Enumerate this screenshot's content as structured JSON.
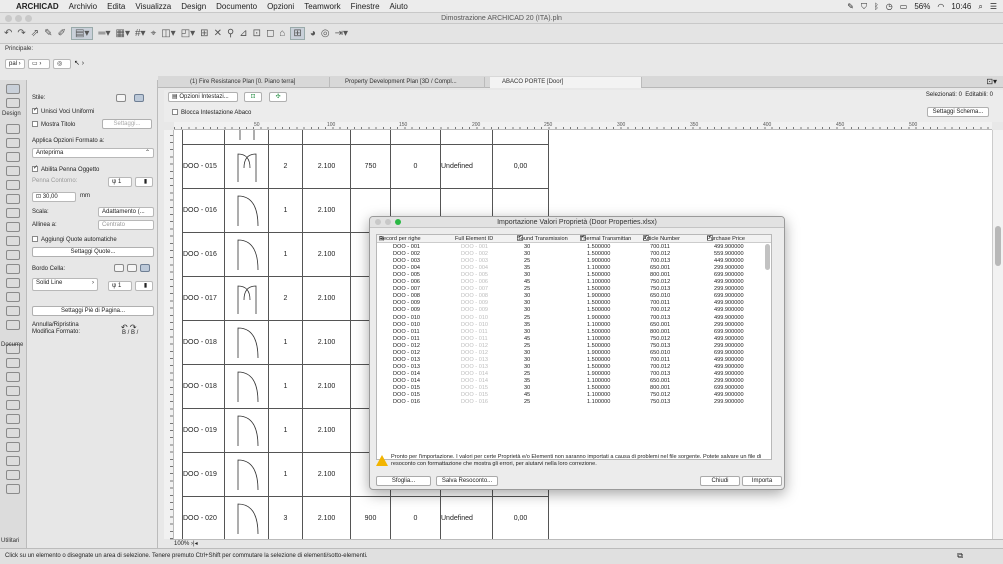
{
  "menubar": {
    "apple": "",
    "app": "ARCHICAD",
    "items": [
      "Archivio",
      "Edita",
      "Visualizza",
      "Design",
      "Documento",
      "Opzioni",
      "Teamwork",
      "Finestre",
      "Aiuto"
    ],
    "battery": "56%",
    "clock": "10:46"
  },
  "window": {
    "title": "Dimostrazione ARCHICAD 20 (ITA).pln"
  },
  "labels": {
    "principale": "Principale:",
    "design": "Design",
    "documento": "Docume",
    "utilities": "Utilitari"
  },
  "panel": {
    "stile_label": "Stile:",
    "unisci_label": "Unisci Voci Uniformi",
    "mostra_titolo_label": "Mostra Titolo",
    "settaggi_label": "Settaggi...",
    "applica_label": "Applica Opzioni Formato a:",
    "anteprima_value": "Anteprima",
    "abilita_penna_label": "Abilita Penna Oggetto",
    "penna_contorno_label": "Penna Contorno:",
    "penna_value": "1",
    "dim_value": "30,00",
    "dim_unit": "mm",
    "scala_label": "Scala:",
    "scala_value": "Adattamento (...",
    "allinea_label": "Allinea a:",
    "allinea_value": "Centrato",
    "aggiungi_label": "Aggiungi Quote automatiche",
    "settaggi_quote_label": "Settaggi Quote...",
    "bordo_cella_label": "Bordo Cella:",
    "line_value": "Solid Line",
    "line_pen_value": "1",
    "settaggi_piede_label": "Settaggi Piè di Pagina...",
    "annulla_label": "Annulla/Ripristina",
    "modifica_label": "Modifica Formato:",
    "undo_glyphs": "B / B /"
  },
  "tabs": [
    {
      "label": "(1) Fire Resistance Plan [0. Piano terra]"
    },
    {
      "label": "Property Development Plan [3D / Compl..."
    },
    {
      "label": "ABACO PORTE [Door]"
    }
  ],
  "schedule": {
    "opzioni_label": "Opzioni Intestazi...",
    "blocca_label": "Blocca Intestazione Abaco",
    "selezionati_label": "Selezionati:",
    "selezionati_value": "0",
    "editabili_label": "Editabili:",
    "editabili_value": "0",
    "settaggi_schema_label": "Settaggi Schema...",
    "zoom_value": "100%"
  },
  "ruler_ticks": [
    "50",
    "100",
    "150",
    "200",
    "250",
    "300",
    "350",
    "400",
    "450",
    "500"
  ],
  "rows": [
    {
      "id": "DOO - 015",
      "qty": "2",
      "h": "2.100",
      "w": "750",
      "v0": "0",
      "v1": "0",
      "status": "Undefined",
      "price": "0,00"
    },
    {
      "id": "DOO - 016",
      "qty": "1",
      "h": "2.100",
      "w": "",
      "v0": "",
      "v1": "",
      "status": "",
      "price": ""
    },
    {
      "id": "DOO - 016",
      "qty": "1",
      "h": "2.100",
      "w": "",
      "v0": "",
      "v1": "",
      "status": "",
      "price": ""
    },
    {
      "id": "DOO - 017",
      "qty": "2",
      "h": "2.100",
      "w": "",
      "v0": "",
      "v1": "",
      "status": "",
      "price": ""
    },
    {
      "id": "DOO - 018",
      "qty": "1",
      "h": "2.100",
      "w": "",
      "v0": "",
      "v1": "",
      "status": "",
      "price": ""
    },
    {
      "id": "DOO - 018",
      "qty": "1",
      "h": "2.100",
      "w": "",
      "v0": "",
      "v1": "",
      "status": "",
      "price": ""
    },
    {
      "id": "DOO - 019",
      "qty": "1",
      "h": "2.100",
      "w": "",
      "v0": "",
      "v1": "",
      "status": "",
      "price": ""
    },
    {
      "id": "DOO - 019",
      "qty": "1",
      "h": "2.100",
      "w": "",
      "v0": "",
      "v1": "",
      "status": "",
      "price": ""
    },
    {
      "id": "DOO - 020",
      "qty": "3",
      "h": "2.100",
      "w": "900",
      "v0": "0",
      "v1": "0",
      "status": "Undefined",
      "price": "0,00"
    }
  ],
  "dialog": {
    "title": "Importazione Valori Proprietà (Door Properties.xlsx)",
    "cols": [
      "Record per righe",
      "Full Element ID",
      "Sound Transmission",
      "Thermal Transmittan",
      "Article Number",
      "Purchase Price"
    ],
    "records": [
      [
        "DOO - 001",
        "DOO - 001",
        "30",
        "1.500000",
        "700.011",
        "499.900000"
      ],
      [
        "DOO - 002",
        "DOO - 002",
        "30",
        "1.500000",
        "700.012",
        "559.900000"
      ],
      [
        "DOO - 003",
        "DOO - 003",
        "25",
        "1.900000",
        "700.013",
        "449.900000"
      ],
      [
        "DOO - 004",
        "DOO - 004",
        "35",
        "1.100000",
        "650.001",
        "299.900000"
      ],
      [
        "DOO - 005",
        "DOO - 005",
        "30",
        "1.500000",
        "800.001",
        "699.900000"
      ],
      [
        "DOO - 006",
        "DOO - 006",
        "45",
        "1.100000",
        "750.012",
        "499.900000"
      ],
      [
        "DOO - 007",
        "DOO - 007",
        "25",
        "1.500000",
        "750.013",
        "299.900000"
      ],
      [
        "DOO - 008",
        "DOO - 008",
        "30",
        "1.900000",
        "650.010",
        "699.900000"
      ],
      [
        "DOO - 009",
        "DOO - 009",
        "30",
        "1.500000",
        "700.011",
        "499.900000"
      ],
      [
        "DOO - 009",
        "DOO - 009",
        "30",
        "1.500000",
        "700.012",
        "499.900000"
      ],
      [
        "DOO - 010",
        "DOO - 010",
        "25",
        "1.900000",
        "700.013",
        "499.900000"
      ],
      [
        "DOO - 010",
        "DOO - 010",
        "35",
        "1.100000",
        "650.001",
        "299.900000"
      ],
      [
        "DOO - 011",
        "DOO - 011",
        "30",
        "1.500000",
        "800.001",
        "699.900000"
      ],
      [
        "DOO - 011",
        "DOO - 011",
        "45",
        "1.100000",
        "750.012",
        "499.900000"
      ],
      [
        "DOO - 012",
        "DOO - 012",
        "25",
        "1.500000",
        "750.013",
        "299.900000"
      ],
      [
        "DOO - 012",
        "DOO - 012",
        "30",
        "1.900000",
        "650.010",
        "699.900000"
      ],
      [
        "DOO - 013",
        "DOO - 013",
        "30",
        "1.500000",
        "700.011",
        "499.900000"
      ],
      [
        "DOO - 013",
        "DOO - 013",
        "30",
        "1.500000",
        "700.012",
        "499.900000"
      ],
      [
        "DOO - 014",
        "DOO - 014",
        "25",
        "1.900000",
        "700.013",
        "499.900000"
      ],
      [
        "DOO - 014",
        "DOO - 014",
        "35",
        "1.100000",
        "650.001",
        "299.900000"
      ],
      [
        "DOO - 015",
        "DOO - 015",
        "30",
        "1.500000",
        "800.001",
        "699.900000"
      ],
      [
        "DOO - 015",
        "DOO - 015",
        "45",
        "1.100000",
        "750.012",
        "499.900000"
      ],
      [
        "DOO - 016",
        "DOO - 016",
        "25",
        "1.100000",
        "750.013",
        "299.900000"
      ]
    ],
    "message": "Pronto per l'importazione. I valori per certe Proprietà e/o Elementi non saranno importati a causa di problemi nel file sorgente. Potete salvare un file di resoconto con formattazione che mostra gli errori, per aiutarvi nella loro correzione.",
    "sfoglia_label": "Sfoglia...",
    "salva_label": "Salva Resoconto...",
    "chiudi_label": "Chiudi",
    "importa_label": "Importa"
  },
  "statusbar": {
    "text": "Click su un elemento o disegnate un area di selezione. Tenere premuto Ctrl+Shift per commutare la selezione di elementi/sotto-elementi."
  }
}
